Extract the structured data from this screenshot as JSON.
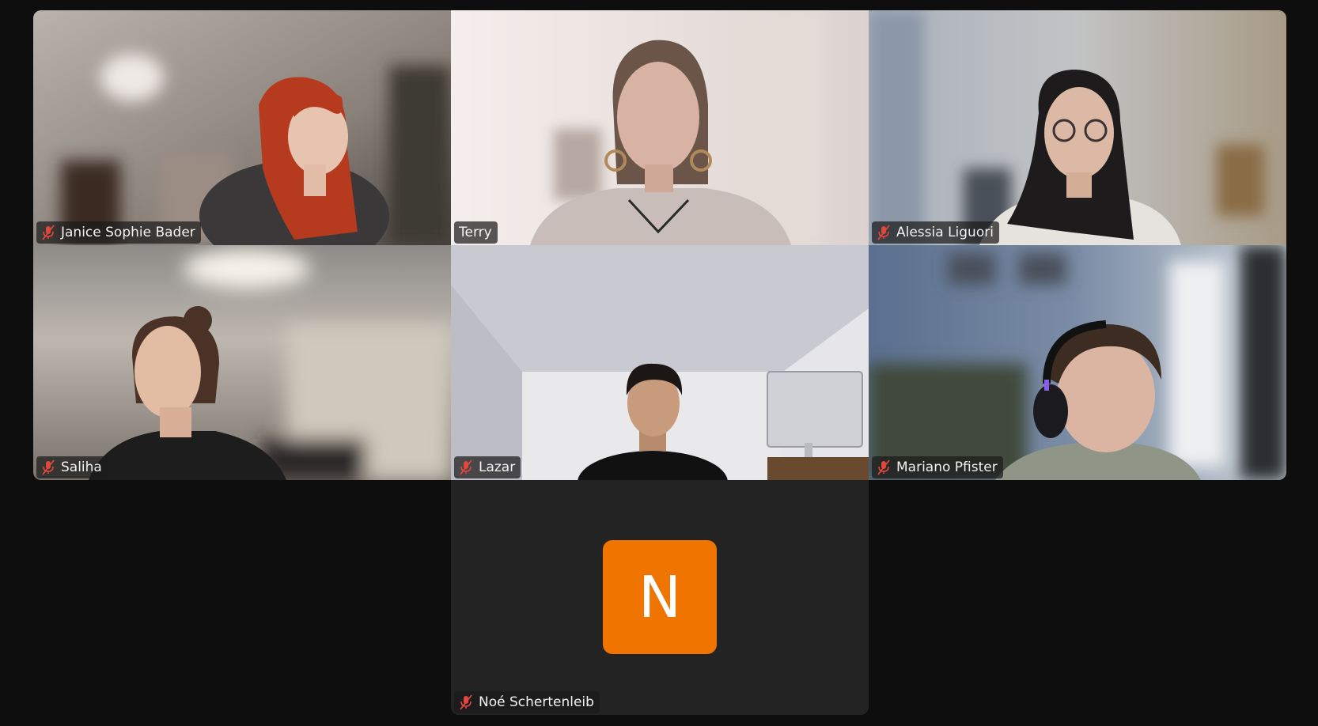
{
  "meeting": {
    "layout": "gallery-view",
    "active_speaker_color": "#2be08a",
    "muted_icon_color": "#e0473d",
    "participants": [
      {
        "name": "Janice Sophie Bader",
        "muted": true,
        "video": true,
        "speaking": false
      },
      {
        "name": "Terry",
        "muted": false,
        "video": true,
        "speaking": true
      },
      {
        "name": "Alessia Liguori",
        "muted": true,
        "video": true,
        "speaking": false
      },
      {
        "name": "Saliha",
        "muted": true,
        "video": true,
        "speaking": false
      },
      {
        "name": "Lazar",
        "muted": true,
        "video": true,
        "speaking": false
      },
      {
        "name": "Mariano Pfister",
        "muted": true,
        "video": true,
        "speaking": false
      },
      {
        "name": "Noé Schertenleib",
        "muted": true,
        "video": false,
        "speaking": false,
        "avatar_letter": "N",
        "avatar_color": "#f07500"
      }
    ]
  }
}
